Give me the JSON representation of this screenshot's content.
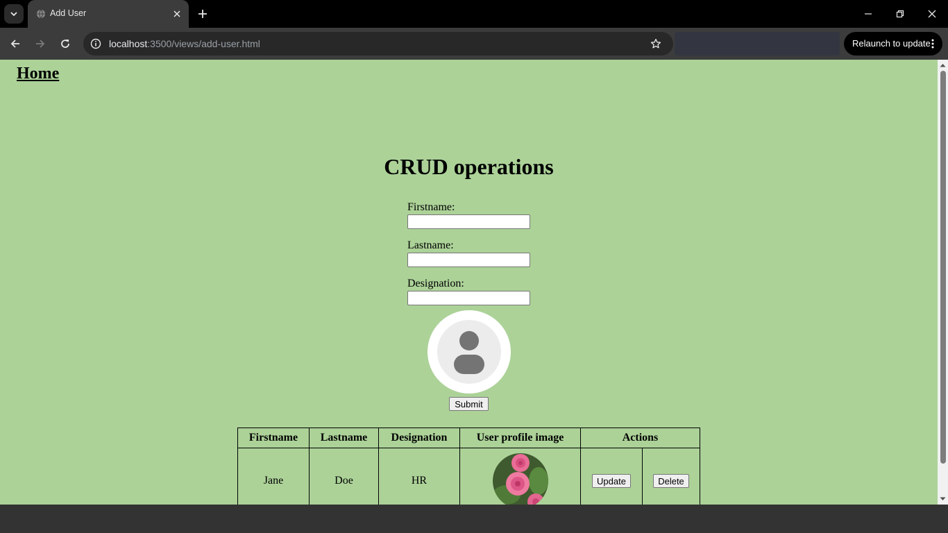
{
  "browser": {
    "tab_title": "Add User",
    "url_host": "localhost",
    "url_path": ":3500/views/add-user.html",
    "relaunch_label": "Relaunch to update"
  },
  "page": {
    "home_link": "Home",
    "title": "CRUD operations",
    "form": {
      "firstname_label": "Firstname:",
      "firstname_value": "",
      "lastname_label": "Lastname:",
      "lastname_value": "",
      "designation_label": "Designation:",
      "designation_value": "",
      "avatar_icon": "person-placeholder-icon",
      "submit_label": "Submit"
    },
    "table": {
      "headers": [
        "Firstname",
        "Lastname",
        "Designation",
        "User profile image",
        "Actions"
      ],
      "rows": [
        {
          "firstname": "Jane",
          "lastname": "Doe",
          "designation": "HR",
          "image": "pink-roses-photo",
          "update_label": "Update",
          "delete_label": "Delete"
        }
      ]
    }
  },
  "colors": {
    "page_background": "#acd298",
    "chrome_dark": "#3c3c3c"
  }
}
